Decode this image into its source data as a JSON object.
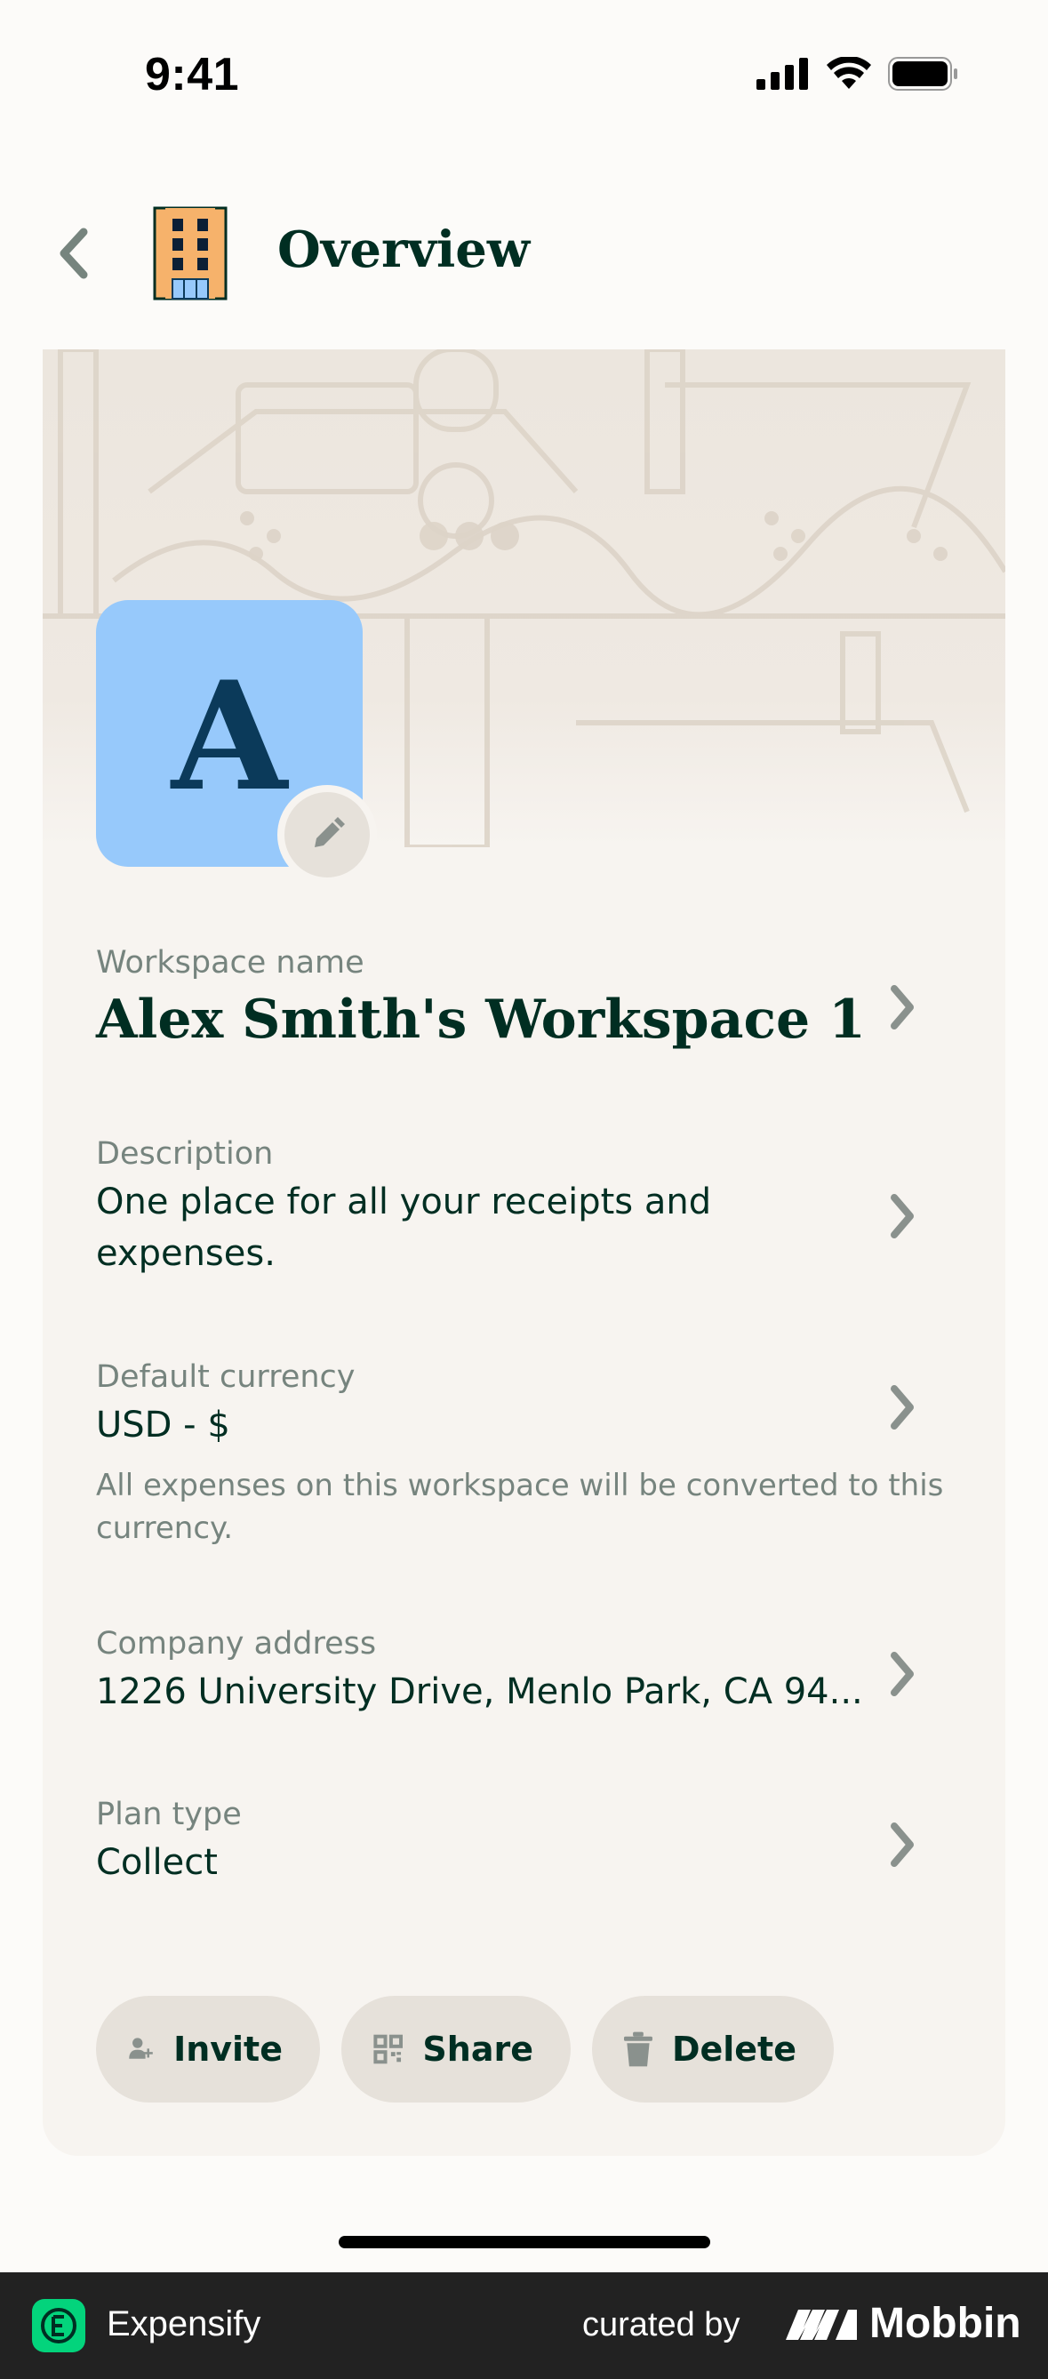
{
  "status_bar": {
    "time": "9:41"
  },
  "header": {
    "title": "Overview",
    "back_icon": "chevron-left-icon",
    "workspace_icon": "building-icon"
  },
  "workspace": {
    "avatar_letter": "A",
    "avatar_color": "#97c9fb",
    "fields": [
      {
        "label": "Workspace name",
        "value": "Alex Smith's Workspace 1"
      },
      {
        "label": "Description",
        "value": "One place for all your receipts and expenses."
      },
      {
        "label": "Default currency",
        "value": "USD - $",
        "hint": "All expenses on this workspace will be converted to this currency."
      },
      {
        "label": "Company address",
        "value": "1226 University Drive, Menlo Park, CA 94..."
      },
      {
        "label": "Plan type",
        "value": "Collect"
      }
    ]
  },
  "actions": {
    "invite": "Invite",
    "share": "Share",
    "delete": "Delete"
  },
  "footer": {
    "app_name": "Expensify",
    "curated_by": "curated by",
    "brand": "Mobbin",
    "accent": "#03d47c"
  }
}
